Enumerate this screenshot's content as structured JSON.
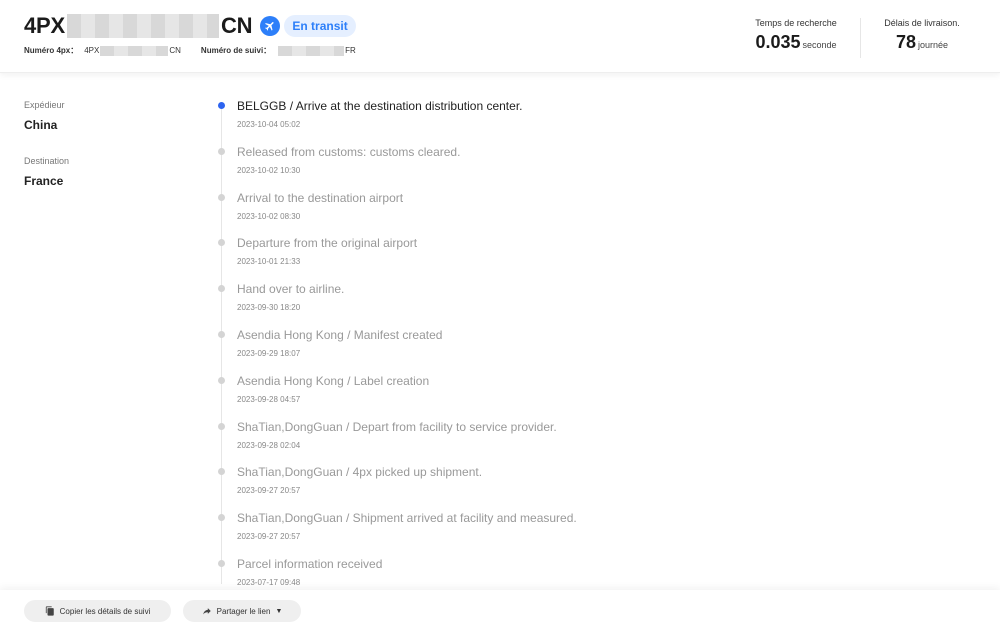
{
  "header": {
    "tracking_prefix": "4PX",
    "tracking_suffix": "CN",
    "status_label": "En transit",
    "status_icon": "airplane-icon",
    "fields": {
      "num4px_label": "Numéro 4px：",
      "num4px_prefix": "4PX",
      "num4px_suffix": "CN",
      "tracking_label": "Numéro de suivi：",
      "tracking_suffix": "FR"
    },
    "stats": {
      "search_time_caption": "Temps de recherche",
      "search_time_value": "0.035",
      "search_time_unit": "seconde",
      "delivery_caption": "Délais de livraison.",
      "delivery_value": "78",
      "delivery_unit": "journée"
    }
  },
  "side": {
    "sender_caption": "Expédieur",
    "sender_value": "China",
    "dest_caption": "Destination",
    "dest_value": "France"
  },
  "events": [
    {
      "text": "BELGGB / Arrive at the destination distribution center.",
      "time": "2023-10-04 05:02",
      "active": true
    },
    {
      "text": "Released from customs: customs cleared.",
      "time": "2023-10-02 10:30",
      "active": false
    },
    {
      "text": "Arrival to the destination airport",
      "time": "2023-10-02 08:30",
      "active": false
    },
    {
      "text": "Departure from the original airport",
      "time": "2023-10-01 21:33",
      "active": false
    },
    {
      "text": "Hand over to airline.",
      "time": "2023-09-30 18:20",
      "active": false
    },
    {
      "text": "Asendia Hong Kong / Manifest created",
      "time": "2023-09-29 18:07",
      "active": false
    },
    {
      "text": "Asendia Hong Kong / Label creation",
      "time": "2023-09-28 04:57",
      "active": false
    },
    {
      "text": "ShaTian,DongGuan / Depart from facility to service provider.",
      "time": "2023-09-28 02:04",
      "active": false
    },
    {
      "text": "ShaTian,DongGuan / 4px picked up shipment.",
      "time": "2023-09-27 20:57",
      "active": false
    },
    {
      "text": "ShaTian,DongGuan / Shipment arrived at facility and measured.",
      "time": "2023-09-27 20:57",
      "active": false
    },
    {
      "text": "Parcel information received",
      "time": "2023-07-17 09:48",
      "active": false
    }
  ],
  "toolbar": {
    "copy_label": "Copier les détails de suivi",
    "copy_icon": "copy-icon",
    "share_label": "Partager le lien",
    "share_icon": "share-icon",
    "share_caret": "▼"
  },
  "colors": {
    "accent": "#2d7ff9",
    "active_dot": "#2d64f0",
    "muted_text": "#999999"
  }
}
